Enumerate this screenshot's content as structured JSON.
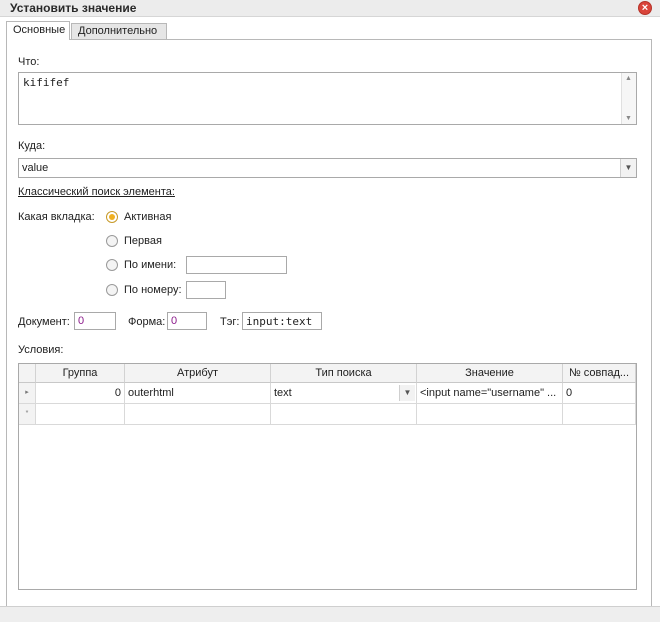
{
  "window": {
    "title": "Установить значение",
    "close_glyph": "×"
  },
  "tabs": [
    {
      "label": "Основные",
      "active": true
    },
    {
      "label": "Дополнительно",
      "active": false
    }
  ],
  "what": {
    "label": "Что:",
    "value": "kififef"
  },
  "where": {
    "label": "Куда:",
    "value": "value"
  },
  "search_section": {
    "title": "Классический поиск элемента:"
  },
  "tab_choice": {
    "label": "Какая вкладка:",
    "options": [
      {
        "label": "Активная",
        "checked": true
      },
      {
        "label": "Первая",
        "checked": false
      },
      {
        "label": "По имени:",
        "checked": false,
        "field_value": ""
      },
      {
        "label": "По номеру:",
        "checked": false,
        "field_value": ""
      }
    ]
  },
  "document": {
    "label": "Документ:",
    "value": "0"
  },
  "form": {
    "label": "Форма:",
    "value": "0"
  },
  "tag": {
    "label": "Тэг:",
    "value": "input:text"
  },
  "conditions": {
    "label": "Условия:",
    "columns": [
      "Группа",
      "Атрибут",
      "Тип поиска",
      "Значение",
      "№ совпад..."
    ],
    "rows": [
      {
        "group": "0",
        "attribute": "outerhtml",
        "search_type": "text",
        "value": "<input name=\"username\" ...",
        "match": "0"
      }
    ],
    "new_row_glyph": "*",
    "current_row_glyph": "▸"
  },
  "colors": {
    "radio_checked": "#f0b020",
    "close": "#d9443a",
    "numeric_value": "#8b1a8b"
  }
}
